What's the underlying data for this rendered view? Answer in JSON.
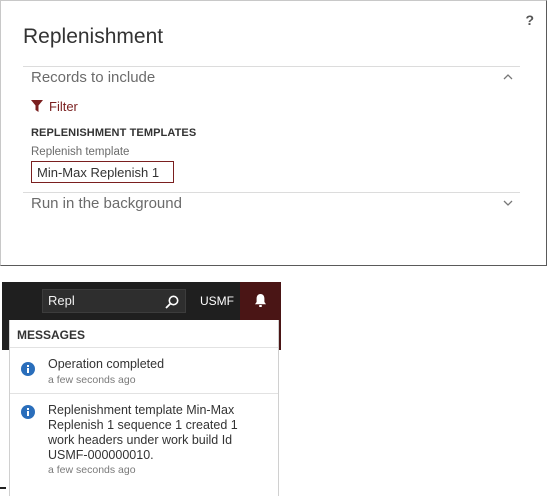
{
  "dialog": {
    "help_label": "?",
    "title": "Replenishment",
    "records_section": "Records to include",
    "filter_label": "Filter",
    "group_title": "REPLENISHMENT TEMPLATES",
    "field_label": "Replenish template",
    "field_value": "Min-Max Replenish 1",
    "background_section": "Run in the background"
  },
  "navbar": {
    "search_value": "Repl",
    "company": "USMF"
  },
  "messages": {
    "title": "MESSAGES",
    "items": [
      {
        "text": "Operation completed",
        "time": "a few seconds ago"
      },
      {
        "text": "Replenishment template Min-Max Replenish 1 sequence 1 created 1 work headers under work build Id USMF-000000010.",
        "time": "a few seconds ago"
      }
    ]
  },
  "colors": {
    "accent": "#7a1f1f",
    "navbar_bg": "#1f1f1f",
    "bell_bg": "#4a1515",
    "info_icon": "#2a6ebb"
  }
}
